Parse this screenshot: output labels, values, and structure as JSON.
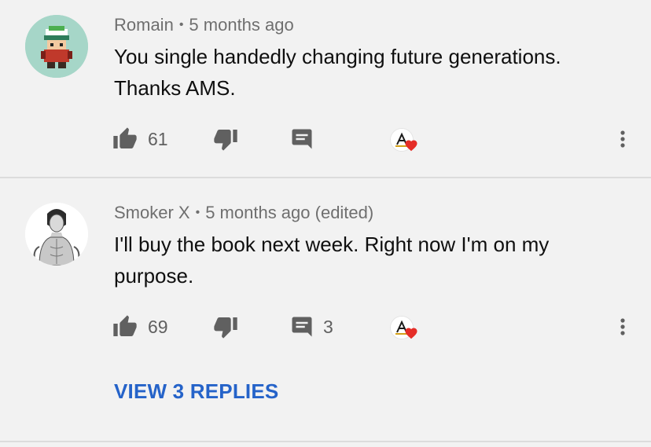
{
  "comments": [
    {
      "author": "Romain",
      "separator": "•",
      "time": "5 months ago",
      "text": "You single handedly changing future generations. Thanks AMS.",
      "likes": "61",
      "replies": "",
      "avatar_icon": "pixel-trainer-avatar-icon",
      "creator_heart": true
    },
    {
      "author": "Smoker X",
      "separator": "•",
      "time": "5 months ago (edited)",
      "text": "I'll buy the book next week. Right now I'm on my purpose.",
      "likes": "69",
      "replies": "3",
      "avatar_icon": "sketch-portrait-avatar-icon",
      "creator_heart": true
    }
  ],
  "view_replies_label": "VIEW 3 REPLIES",
  "colors": {
    "background": "#f2f2f2",
    "icon_gray": "#606060",
    "link_blue": "#2563c9",
    "heart_red": "#e52d27"
  }
}
